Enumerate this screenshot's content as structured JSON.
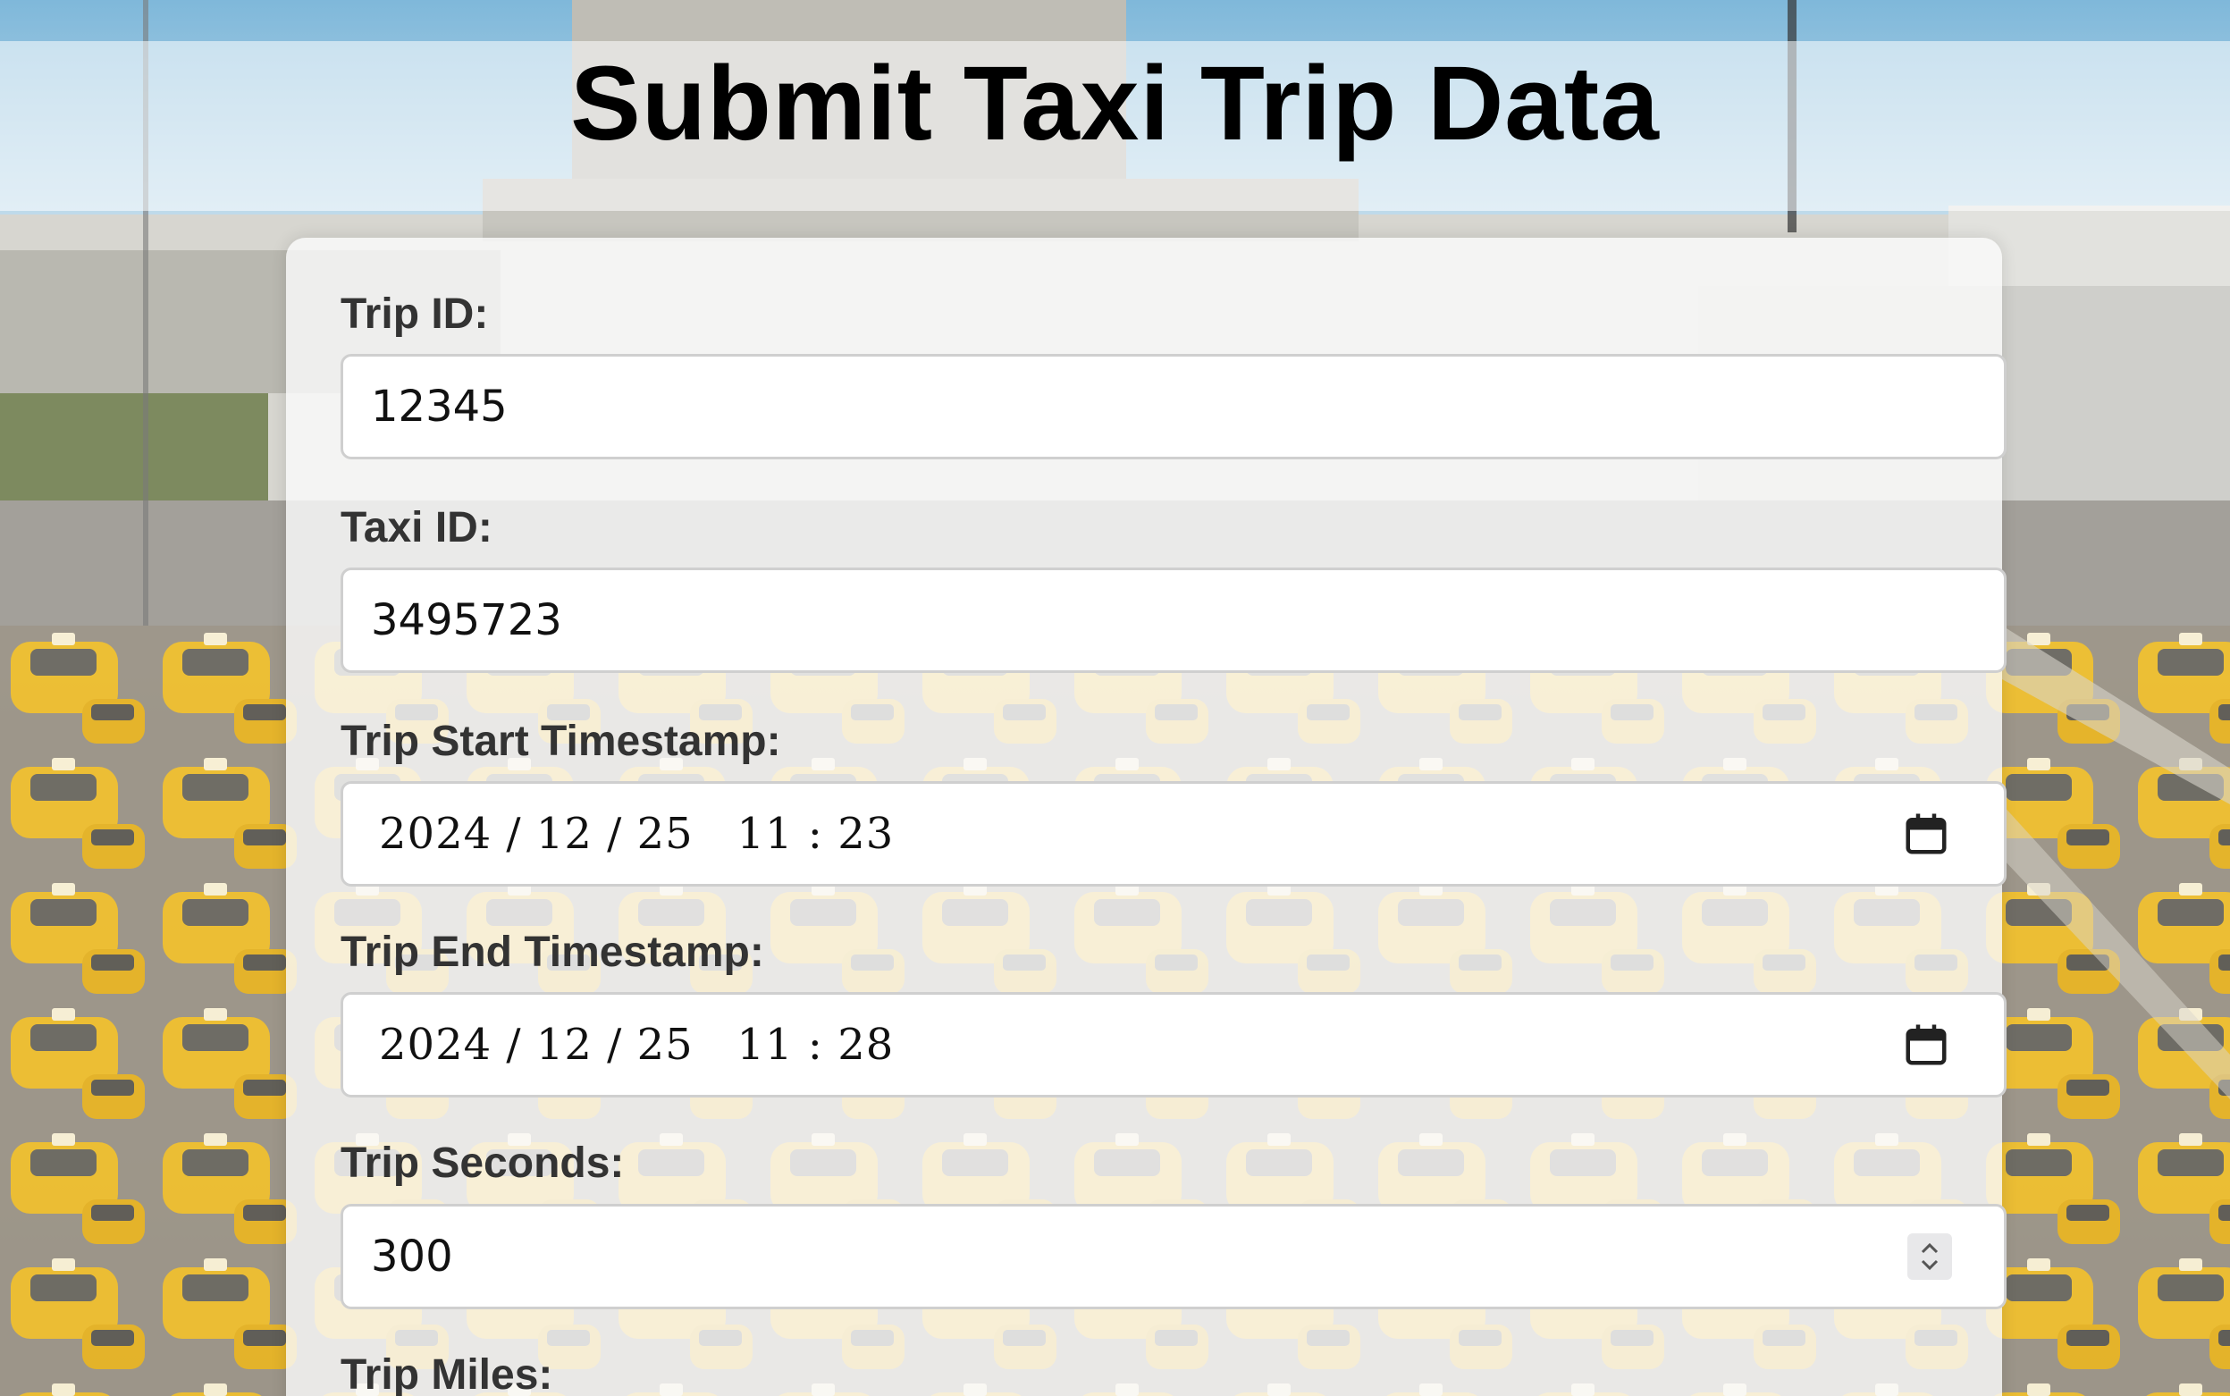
{
  "page": {
    "title": "Submit Taxi Trip Data"
  },
  "form": {
    "fields": [
      {
        "label": "Trip ID:",
        "value": "12345",
        "type": "text"
      },
      {
        "label": "Taxi ID:",
        "value": "3495723",
        "type": "text"
      },
      {
        "label": "Trip Start Timestamp:",
        "value": "2024 / 12 / 25   11 : 23",
        "type": "datetime",
        "icon": "calendar-icon"
      },
      {
        "label": "Trip End Timestamp:",
        "value": "2024 / 12 / 25   11 : 28",
        "type": "datetime",
        "icon": "calendar-icon"
      },
      {
        "label": "Trip Seconds:",
        "value": "300",
        "type": "number",
        "icon": "spinner-icon"
      },
      {
        "label": "Trip Miles:",
        "value": "",
        "type": "number"
      }
    ]
  },
  "colors": {
    "taxi_yellow": "#f2c12e",
    "sky": "#8fc0dc",
    "card": "#fafafa",
    "label_text": "#333333"
  }
}
